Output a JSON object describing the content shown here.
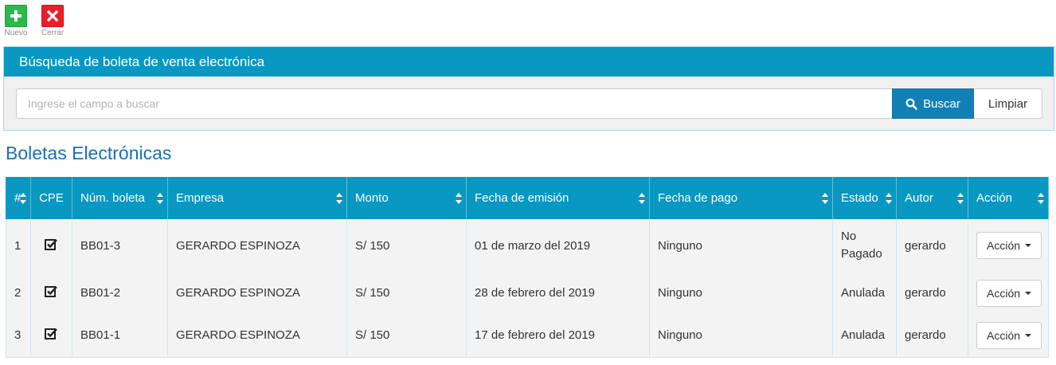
{
  "toolbar": {
    "nuevo_label": "Nuevo",
    "cerrar_label": "Cerrar",
    "nuevo_color": "#2db84c",
    "cerrar_color": "#e8202c"
  },
  "search_panel": {
    "title": "Búsqueda de boleta de venta electrónica",
    "placeholder": "Ingrese el campo a buscar",
    "value": "",
    "search_button": "Buscar",
    "clear_button": "Limpiar",
    "accent_color": "#0898c2"
  },
  "section_title": "Boletas Electrónicas",
  "table": {
    "columns": [
      "#",
      "CPE",
      "Núm. boleta",
      "Empresa",
      "Monto",
      "Fecha de emisión",
      "Fecha de pago",
      "Estado",
      "Autor",
      "Acción"
    ],
    "rows": [
      {
        "index": "1",
        "cpe": "checked",
        "boleta": "BB01-3",
        "empresa": "GERARDO ESPINOZA",
        "monto": "S/ 150",
        "fecha_emision": "01 de marzo del 2019",
        "fecha_pago": "Ninguno",
        "estado": "No Pagado",
        "autor": "gerardo",
        "accion": "Acción"
      },
      {
        "index": "2",
        "cpe": "checked",
        "boleta": "BB01-2",
        "empresa": "GERARDO ESPINOZA",
        "monto": "S/ 150",
        "fecha_emision": "28 de febrero del 2019",
        "fecha_pago": "Ninguno",
        "estado": "Anulada",
        "autor": "gerardo",
        "accion": "Acción"
      },
      {
        "index": "3",
        "cpe": "checked",
        "boleta": "BB01-1",
        "empresa": "GERARDO ESPINOZA",
        "monto": "S/ 150",
        "fecha_emision": "17 de febrero del 2019",
        "fecha_pago": "Ninguno",
        "estado": "Anulada",
        "autor": "gerardo",
        "accion": "Acción"
      }
    ]
  }
}
